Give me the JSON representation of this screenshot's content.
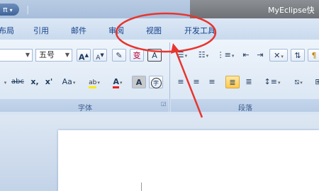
{
  "titlebar": {
    "app_badge": "π",
    "quick_access_sep": "⏐",
    "window_title": "MyEclipse快"
  },
  "tabs": [
    {
      "name": "tab-layout",
      "label": "布局"
    },
    {
      "name": "tab-references",
      "label": "引用"
    },
    {
      "name": "tab-mailings",
      "label": "邮件"
    },
    {
      "name": "tab-review",
      "label": "审阅"
    },
    {
      "name": "tab-view",
      "label": "视图"
    },
    {
      "name": "tab-developer",
      "label": "开发工具"
    }
  ],
  "font_group": {
    "font_size": "五号",
    "grow_font": "A",
    "shrink_font": "A",
    "phonetic": "变",
    "char_border": "A",
    "strikethrough": "abc",
    "subscript": "x,",
    "superscript": "x'",
    "change_case": "Aa",
    "highlight": "ab",
    "font_color": "A",
    "char_shading": "A",
    "enclose": "字",
    "label": "字体",
    "launcher": "◲"
  },
  "paragraph_group": {
    "label": "段落"
  },
  "colors": {
    "annotation_red": "#e8352e",
    "highlight_yellow": "#ffe800",
    "font_color_red": "#e52222"
  }
}
